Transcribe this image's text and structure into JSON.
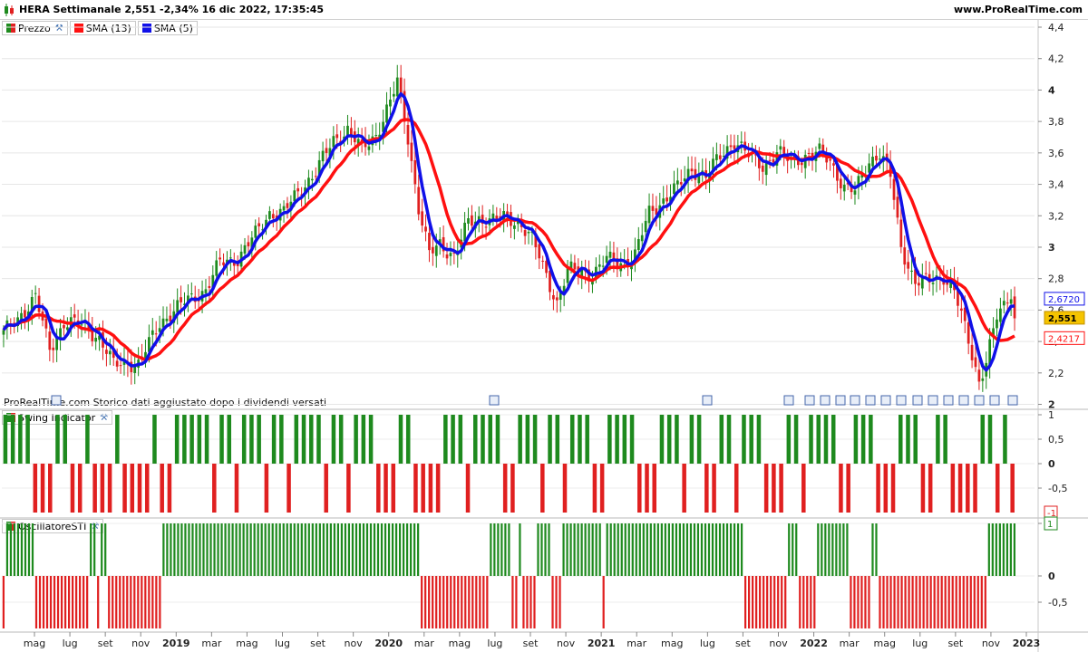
{
  "header": {
    "title": "HERA Settimanale 2,551 -2,34% 16 dic 2022, 17:35:45",
    "site": "www.ProRealTime.com"
  },
  "legend": {
    "price": "Prezzo",
    "sma13": "SMA (13)",
    "sma5": "SMA (5)",
    "swing": "Swing Indicator",
    "osc": "OscillatoreSTI"
  },
  "footnote": "ProRealTime.com  Storico dati aggiustato dopo i dividendi versati",
  "colors": {
    "up": "#1e8a1e",
    "down": "#e02020",
    "sma13": "#ff1010",
    "sma5": "#1010e8",
    "price_tag": "#f5c400"
  },
  "chart_data": [
    {
      "type": "candlestick",
      "panel": "price",
      "ylim": [
        1.98,
        4.4
      ],
      "yticks": [
        "2",
        "2,2",
        "2,4",
        "2,6",
        "2,8",
        "3",
        "3,2",
        "3,4",
        "3,6",
        "3,8",
        "4",
        "4,2",
        "4,4"
      ],
      "last_price": "2,551",
      "sma13_label": "2,4217",
      "sma5_label": "2,6720",
      "anchors_close": [
        [
          0,
          2.45
        ],
        [
          4,
          2.55
        ],
        [
          9,
          2.68
        ],
        [
          13,
          2.35
        ],
        [
          17,
          2.52
        ],
        [
          23,
          2.5
        ],
        [
          27,
          2.42
        ],
        [
          31,
          2.25
        ],
        [
          35,
          2.27
        ],
        [
          38,
          2.25
        ],
        [
          44,
          2.52
        ],
        [
          51,
          2.65
        ],
        [
          57,
          2.73
        ],
        [
          61,
          2.9
        ],
        [
          66,
          2.93
        ],
        [
          71,
          3.08
        ],
        [
          75,
          3.22
        ],
        [
          79,
          3.22
        ],
        [
          84,
          3.38
        ],
        [
          88,
          3.48
        ],
        [
          93,
          3.68
        ],
        [
          97,
          3.75
        ],
        [
          101,
          3.62
        ],
        [
          105,
          3.72
        ],
        [
          109,
          3.92
        ],
        [
          111,
          4.05
        ],
        [
          114,
          3.7
        ],
        [
          117,
          3.25
        ],
        [
          120,
          2.95
        ],
        [
          123,
          3.02
        ],
        [
          127,
          2.95
        ],
        [
          131,
          3.15
        ],
        [
          134,
          3.18
        ],
        [
          138,
          3.18
        ],
        [
          142,
          3.18
        ],
        [
          146,
          3.15
        ],
        [
          149,
          3.05
        ],
        [
          153,
          2.82
        ],
        [
          156,
          2.65
        ],
        [
          159,
          2.85
        ],
        [
          162,
          2.85
        ],
        [
          166,
          2.83
        ],
        [
          170,
          2.92
        ],
        [
          174,
          2.9
        ],
        [
          178,
          2.95
        ],
        [
          182,
          3.22
        ],
        [
          186,
          3.3
        ],
        [
          190,
          3.38
        ],
        [
          194,
          3.5
        ],
        [
          198,
          3.45
        ],
        [
          202,
          3.58
        ],
        [
          206,
          3.68
        ],
        [
          210,
          3.58
        ],
        [
          214,
          3.52
        ],
        [
          218,
          3.6
        ],
        [
          222,
          3.55
        ],
        [
          226,
          3.58
        ],
        [
          230,
          3.6
        ],
        [
          233,
          3.55
        ],
        [
          237,
          3.38
        ],
        [
          240,
          3.35
        ],
        [
          244,
          3.55
        ],
        [
          247,
          3.6
        ],
        [
          250,
          3.45
        ],
        [
          253,
          3.0
        ],
        [
          257,
          2.78
        ],
        [
          261,
          2.78
        ],
        [
          265,
          2.82
        ],
        [
          268,
          2.72
        ],
        [
          272,
          2.4
        ],
        [
          275,
          2.15
        ],
        [
          277,
          2.28
        ],
        [
          280,
          2.55
        ],
        [
          282,
          2.62
        ],
        [
          284,
          2.72
        ],
        [
          285,
          2.55
        ]
      ],
      "dividend_icons": 18
    },
    {
      "type": "bar",
      "panel": "Swing Indicator",
      "ylim": [
        -1,
        1
      ],
      "yticks": [
        "1",
        "0,5",
        "0",
        "-0,5"
      ],
      "last_value_label": "-1",
      "values_runs": [
        [
          1,
          4
        ],
        [
          -1,
          3
        ],
        [
          1,
          2
        ],
        [
          -1,
          2
        ],
        [
          1,
          1
        ],
        [
          -1,
          3
        ],
        [
          1,
          1
        ],
        [
          -1,
          4
        ],
        [
          1,
          1
        ],
        [
          -1,
          2
        ],
        [
          1,
          5
        ],
        [
          -1,
          1
        ],
        [
          1,
          2
        ],
        [
          -1,
          1
        ],
        [
          1,
          3
        ],
        [
          -1,
          1
        ],
        [
          1,
          2
        ],
        [
          -1,
          1
        ],
        [
          1,
          4
        ],
        [
          -1,
          1
        ],
        [
          1,
          2
        ],
        [
          -1,
          1
        ],
        [
          1,
          3
        ],
        [
          -1,
          3
        ],
        [
          1,
          2
        ],
        [
          -1,
          4
        ],
        [
          1,
          3
        ],
        [
          -1,
          1
        ],
        [
          1,
          4
        ],
        [
          -1,
          2
        ],
        [
          1,
          3
        ],
        [
          -1,
          1
        ],
        [
          1,
          2
        ],
        [
          -1,
          1
        ],
        [
          1,
          3
        ],
        [
          -1,
          2
        ],
        [
          1,
          4
        ],
        [
          -1,
          3
        ],
        [
          1,
          3
        ],
        [
          -1,
          1
        ],
        [
          1,
          2
        ],
        [
          -1,
          2
        ],
        [
          1,
          2
        ],
        [
          -1,
          1
        ],
        [
          1,
          3
        ],
        [
          -1,
          3
        ],
        [
          1,
          2
        ],
        [
          -1,
          1
        ],
        [
          1,
          4
        ],
        [
          -1,
          2
        ],
        [
          1,
          3
        ],
        [
          -1,
          3
        ],
        [
          1,
          3
        ],
        [
          -1,
          2
        ],
        [
          1,
          2
        ],
        [
          -1,
          4
        ],
        [
          1,
          2
        ],
        [
          -1,
          1
        ],
        [
          1,
          1
        ],
        [
          -1,
          1
        ]
      ]
    },
    {
      "type": "bar",
      "panel": "OscillatoreSTI",
      "ylim": [
        -1,
        1
      ],
      "yticks": [
        "1",
        "0",
        "-0,5"
      ],
      "last_value_label": "1",
      "values_runs": [
        [
          -1,
          1
        ],
        [
          1,
          8
        ],
        [
          -1,
          15
        ],
        [
          1,
          2
        ],
        [
          -1,
          1
        ],
        [
          1,
          2
        ],
        [
          -1,
          15
        ],
        [
          1,
          71
        ],
        [
          -1,
          19
        ],
        [
          1,
          6
        ],
        [
          -1,
          2
        ],
        [
          1,
          1
        ],
        [
          -1,
          4
        ],
        [
          1,
          4
        ],
        [
          -1,
          3
        ],
        [
          1,
          11
        ],
        [
          -1,
          1
        ],
        [
          1,
          38
        ],
        [
          -1,
          12
        ],
        [
          1,
          3
        ],
        [
          -1,
          5
        ],
        [
          1,
          9
        ],
        [
          -1,
          6
        ],
        [
          1,
          2
        ],
        [
          -1,
          30
        ],
        [
          1,
          8
        ]
      ]
    }
  ],
  "x_axis": {
    "labels": [
      {
        "t": "mag",
        "bold": false
      },
      {
        "t": "lug",
        "bold": false
      },
      {
        "t": "set",
        "bold": false
      },
      {
        "t": "nov",
        "bold": false
      },
      {
        "t": "2019",
        "bold": true
      },
      {
        "t": "mar",
        "bold": false
      },
      {
        "t": "mag",
        "bold": false
      },
      {
        "t": "lug",
        "bold": false
      },
      {
        "t": "set",
        "bold": false
      },
      {
        "t": "nov",
        "bold": false
      },
      {
        "t": "2020",
        "bold": true
      },
      {
        "t": "mar",
        "bold": false
      },
      {
        "t": "mag",
        "bold": false
      },
      {
        "t": "lug",
        "bold": false
      },
      {
        "t": "set",
        "bold": false
      },
      {
        "t": "nov",
        "bold": false
      },
      {
        "t": "2021",
        "bold": true
      },
      {
        "t": "mar",
        "bold": false
      },
      {
        "t": "mag",
        "bold": false
      },
      {
        "t": "lug",
        "bold": false
      },
      {
        "t": "set",
        "bold": false
      },
      {
        "t": "nov",
        "bold": false
      },
      {
        "t": "2022",
        "bold": true
      },
      {
        "t": "mar",
        "bold": false
      },
      {
        "t": "mag",
        "bold": false
      },
      {
        "t": "lug",
        "bold": false
      },
      {
        "t": "set",
        "bold": false
      },
      {
        "t": "nov",
        "bold": false
      },
      {
        "t": "2023",
        "bold": true
      }
    ]
  }
}
